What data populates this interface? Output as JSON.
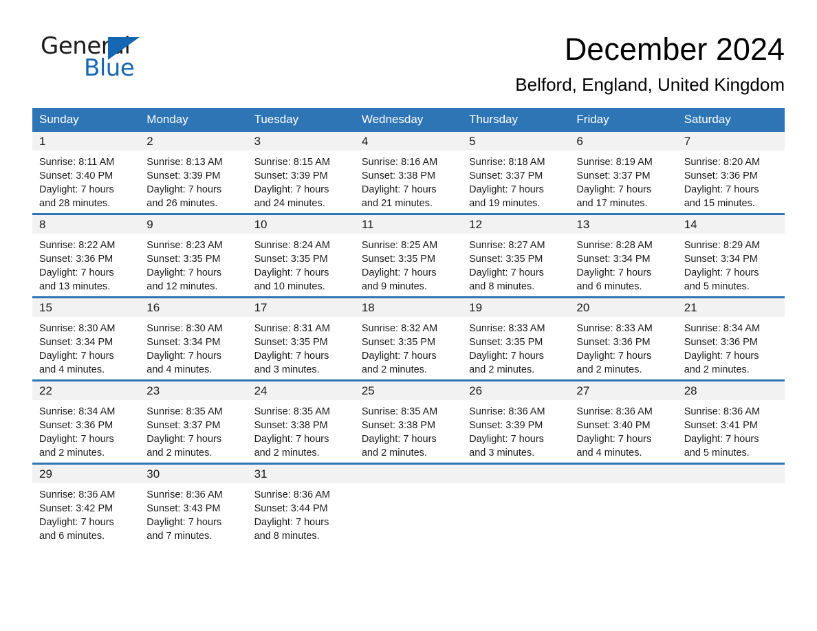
{
  "brand": {
    "name_part1": "General",
    "name_part2": "Blue",
    "accent_color": "#1667b2",
    "logo_icon": "triangle-icon"
  },
  "header": {
    "title": "December 2024",
    "location": "Belford, England, United Kingdom"
  },
  "calendar": {
    "header_bg": "#2e75b6",
    "daynum_bg": "#f2f2f2",
    "weekday_headers": [
      "Sunday",
      "Monday",
      "Tuesday",
      "Wednesday",
      "Thursday",
      "Friday",
      "Saturday"
    ],
    "weeks": [
      [
        {
          "day": "1",
          "sunrise": "Sunrise: 8:11 AM",
          "sunset": "Sunset: 3:40 PM",
          "daylight_1": "Daylight: 7 hours",
          "daylight_2": "and 28 minutes."
        },
        {
          "day": "2",
          "sunrise": "Sunrise: 8:13 AM",
          "sunset": "Sunset: 3:39 PM",
          "daylight_1": "Daylight: 7 hours",
          "daylight_2": "and 26 minutes."
        },
        {
          "day": "3",
          "sunrise": "Sunrise: 8:15 AM",
          "sunset": "Sunset: 3:39 PM",
          "daylight_1": "Daylight: 7 hours",
          "daylight_2": "and 24 minutes."
        },
        {
          "day": "4",
          "sunrise": "Sunrise: 8:16 AM",
          "sunset": "Sunset: 3:38 PM",
          "daylight_1": "Daylight: 7 hours",
          "daylight_2": "and 21 minutes."
        },
        {
          "day": "5",
          "sunrise": "Sunrise: 8:18 AM",
          "sunset": "Sunset: 3:37 PM",
          "daylight_1": "Daylight: 7 hours",
          "daylight_2": "and 19 minutes."
        },
        {
          "day": "6",
          "sunrise": "Sunrise: 8:19 AM",
          "sunset": "Sunset: 3:37 PM",
          "daylight_1": "Daylight: 7 hours",
          "daylight_2": "and 17 minutes."
        },
        {
          "day": "7",
          "sunrise": "Sunrise: 8:20 AM",
          "sunset": "Sunset: 3:36 PM",
          "daylight_1": "Daylight: 7 hours",
          "daylight_2": "and 15 minutes."
        }
      ],
      [
        {
          "day": "8",
          "sunrise": "Sunrise: 8:22 AM",
          "sunset": "Sunset: 3:36 PM",
          "daylight_1": "Daylight: 7 hours",
          "daylight_2": "and 13 minutes."
        },
        {
          "day": "9",
          "sunrise": "Sunrise: 8:23 AM",
          "sunset": "Sunset: 3:35 PM",
          "daylight_1": "Daylight: 7 hours",
          "daylight_2": "and 12 minutes."
        },
        {
          "day": "10",
          "sunrise": "Sunrise: 8:24 AM",
          "sunset": "Sunset: 3:35 PM",
          "daylight_1": "Daylight: 7 hours",
          "daylight_2": "and 10 minutes."
        },
        {
          "day": "11",
          "sunrise": "Sunrise: 8:25 AM",
          "sunset": "Sunset: 3:35 PM",
          "daylight_1": "Daylight: 7 hours",
          "daylight_2": "and 9 minutes."
        },
        {
          "day": "12",
          "sunrise": "Sunrise: 8:27 AM",
          "sunset": "Sunset: 3:35 PM",
          "daylight_1": "Daylight: 7 hours",
          "daylight_2": "and 8 minutes."
        },
        {
          "day": "13",
          "sunrise": "Sunrise: 8:28 AM",
          "sunset": "Sunset: 3:34 PM",
          "daylight_1": "Daylight: 7 hours",
          "daylight_2": "and 6 minutes."
        },
        {
          "day": "14",
          "sunrise": "Sunrise: 8:29 AM",
          "sunset": "Sunset: 3:34 PM",
          "daylight_1": "Daylight: 7 hours",
          "daylight_2": "and 5 minutes."
        }
      ],
      [
        {
          "day": "15",
          "sunrise": "Sunrise: 8:30 AM",
          "sunset": "Sunset: 3:34 PM",
          "daylight_1": "Daylight: 7 hours",
          "daylight_2": "and 4 minutes."
        },
        {
          "day": "16",
          "sunrise": "Sunrise: 8:30 AM",
          "sunset": "Sunset: 3:34 PM",
          "daylight_1": "Daylight: 7 hours",
          "daylight_2": "and 4 minutes."
        },
        {
          "day": "17",
          "sunrise": "Sunrise: 8:31 AM",
          "sunset": "Sunset: 3:35 PM",
          "daylight_1": "Daylight: 7 hours",
          "daylight_2": "and 3 minutes."
        },
        {
          "day": "18",
          "sunrise": "Sunrise: 8:32 AM",
          "sunset": "Sunset: 3:35 PM",
          "daylight_1": "Daylight: 7 hours",
          "daylight_2": "and 2 minutes."
        },
        {
          "day": "19",
          "sunrise": "Sunrise: 8:33 AM",
          "sunset": "Sunset: 3:35 PM",
          "daylight_1": "Daylight: 7 hours",
          "daylight_2": "and 2 minutes."
        },
        {
          "day": "20",
          "sunrise": "Sunrise: 8:33 AM",
          "sunset": "Sunset: 3:36 PM",
          "daylight_1": "Daylight: 7 hours",
          "daylight_2": "and 2 minutes."
        },
        {
          "day": "21",
          "sunrise": "Sunrise: 8:34 AM",
          "sunset": "Sunset: 3:36 PM",
          "daylight_1": "Daylight: 7 hours",
          "daylight_2": "and 2 minutes."
        }
      ],
      [
        {
          "day": "22",
          "sunrise": "Sunrise: 8:34 AM",
          "sunset": "Sunset: 3:36 PM",
          "daylight_1": "Daylight: 7 hours",
          "daylight_2": "and 2 minutes."
        },
        {
          "day": "23",
          "sunrise": "Sunrise: 8:35 AM",
          "sunset": "Sunset: 3:37 PM",
          "daylight_1": "Daylight: 7 hours",
          "daylight_2": "and 2 minutes."
        },
        {
          "day": "24",
          "sunrise": "Sunrise: 8:35 AM",
          "sunset": "Sunset: 3:38 PM",
          "daylight_1": "Daylight: 7 hours",
          "daylight_2": "and 2 minutes."
        },
        {
          "day": "25",
          "sunrise": "Sunrise: 8:35 AM",
          "sunset": "Sunset: 3:38 PM",
          "daylight_1": "Daylight: 7 hours",
          "daylight_2": "and 2 minutes."
        },
        {
          "day": "26",
          "sunrise": "Sunrise: 8:36 AM",
          "sunset": "Sunset: 3:39 PM",
          "daylight_1": "Daylight: 7 hours",
          "daylight_2": "and 3 minutes."
        },
        {
          "day": "27",
          "sunrise": "Sunrise: 8:36 AM",
          "sunset": "Sunset: 3:40 PM",
          "daylight_1": "Daylight: 7 hours",
          "daylight_2": "and 4 minutes."
        },
        {
          "day": "28",
          "sunrise": "Sunrise: 8:36 AM",
          "sunset": "Sunset: 3:41 PM",
          "daylight_1": "Daylight: 7 hours",
          "daylight_2": "and 5 minutes."
        }
      ],
      [
        {
          "day": "29",
          "sunrise": "Sunrise: 8:36 AM",
          "sunset": "Sunset: 3:42 PM",
          "daylight_1": "Daylight: 7 hours",
          "daylight_2": "and 6 minutes."
        },
        {
          "day": "30",
          "sunrise": "Sunrise: 8:36 AM",
          "sunset": "Sunset: 3:43 PM",
          "daylight_1": "Daylight: 7 hours",
          "daylight_2": "and 7 minutes."
        },
        {
          "day": "31",
          "sunrise": "Sunrise: 8:36 AM",
          "sunset": "Sunset: 3:44 PM",
          "daylight_1": "Daylight: 7 hours",
          "daylight_2": "and 8 minutes."
        },
        {
          "day": "",
          "sunrise": "",
          "sunset": "",
          "daylight_1": "",
          "daylight_2": ""
        },
        {
          "day": "",
          "sunrise": "",
          "sunset": "",
          "daylight_1": "",
          "daylight_2": ""
        },
        {
          "day": "",
          "sunrise": "",
          "sunset": "",
          "daylight_1": "",
          "daylight_2": ""
        },
        {
          "day": "",
          "sunrise": "",
          "sunset": "",
          "daylight_1": "",
          "daylight_2": ""
        }
      ]
    ]
  }
}
